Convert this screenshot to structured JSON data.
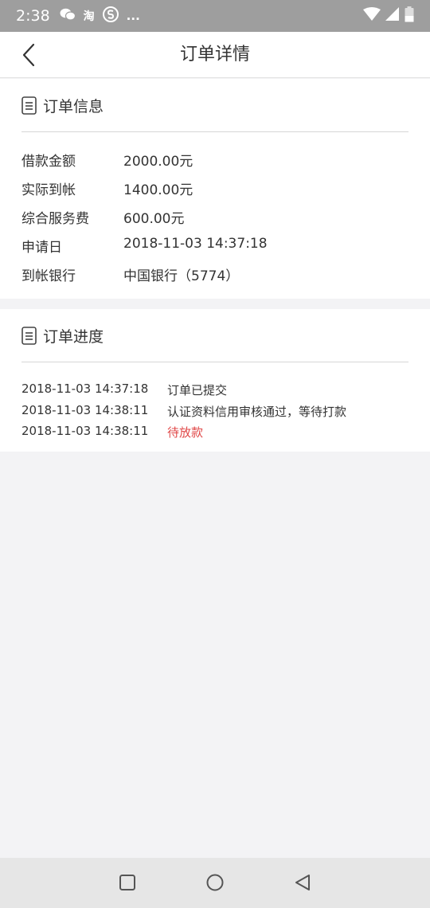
{
  "status_bar": {
    "time": "2:38",
    "left_icons": [
      "wechat-icon",
      "taobao-icon",
      "s-app-icon"
    ],
    "more": "...",
    "taobao_glyph": "淘"
  },
  "header": {
    "title": "订单详情"
  },
  "order_info": {
    "title": "订单信息",
    "rows": [
      {
        "label": "借款金额",
        "value": "2000.00元"
      },
      {
        "label": "实际到帐",
        "value": "1400.00元"
      },
      {
        "label": "综合服务费",
        "value": "600.00元"
      },
      {
        "label": "申请日",
        "value": "2018-11-03 14:37:18"
      },
      {
        "label": "到帐银行",
        "value": "中国银行（5774）"
      }
    ]
  },
  "order_progress": {
    "title": "订单进度",
    "rows": [
      {
        "time": "2018-11-03 14:37:18",
        "status": "订单已提交"
      },
      {
        "time": "2018-11-03 14:38:11",
        "status": "认证资料信用审核通过，等待打款"
      },
      {
        "time": "2018-11-03 14:38:11",
        "status": "待放款"
      }
    ]
  },
  "colors": {
    "pending_status": "#e04848",
    "status_bar": "#9e9e9e",
    "background": "#f3f3f5"
  }
}
